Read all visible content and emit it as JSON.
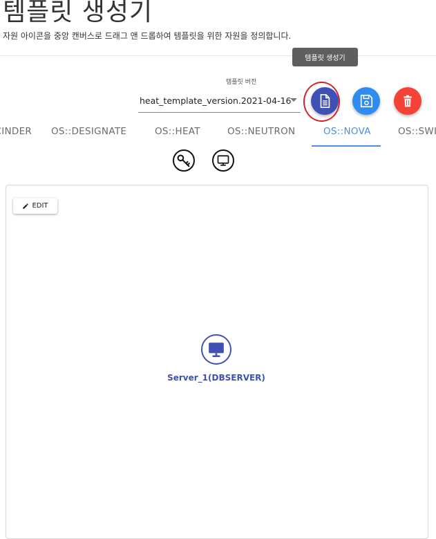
{
  "page": {
    "title": "템플릿 생성기",
    "description": "자원 아이콘을 중앙 캔버스로 드래그 앤 드롭하여 템플릿을 위한 자원을 정의합니다."
  },
  "tooltip": {
    "text": "템플릿 생성기"
  },
  "version": {
    "label": "템플릿 버전",
    "selected": "heat_template_version.2021-04-16"
  },
  "actions": {
    "generate_icon": "document-icon",
    "save_icon": "floppy-disk-icon",
    "delete_icon": "trash-icon"
  },
  "tabs": [
    {
      "label": "OS::CINDER"
    },
    {
      "label": "OS::DESIGNATE"
    },
    {
      "label": "OS::HEAT"
    },
    {
      "label": "OS::NEUTRON"
    },
    {
      "label": "OS::NOVA"
    },
    {
      "label": "OS::SWIFT"
    }
  ],
  "active_tab": "OS::NOVA",
  "resource_tools": [
    {
      "icon": "key-icon"
    },
    {
      "icon": "monitor-icon"
    }
  ],
  "canvas": {
    "edit_label": "EDIT",
    "node": {
      "label": "Server_1(DBSERVER)",
      "icon": "monitor-icon"
    }
  },
  "colors": {
    "primary": "#3f51b5",
    "save": "#2f8cf0",
    "delete": "#f44336",
    "active_tab": "#4a8fe2",
    "highlight": "#d6202b"
  }
}
